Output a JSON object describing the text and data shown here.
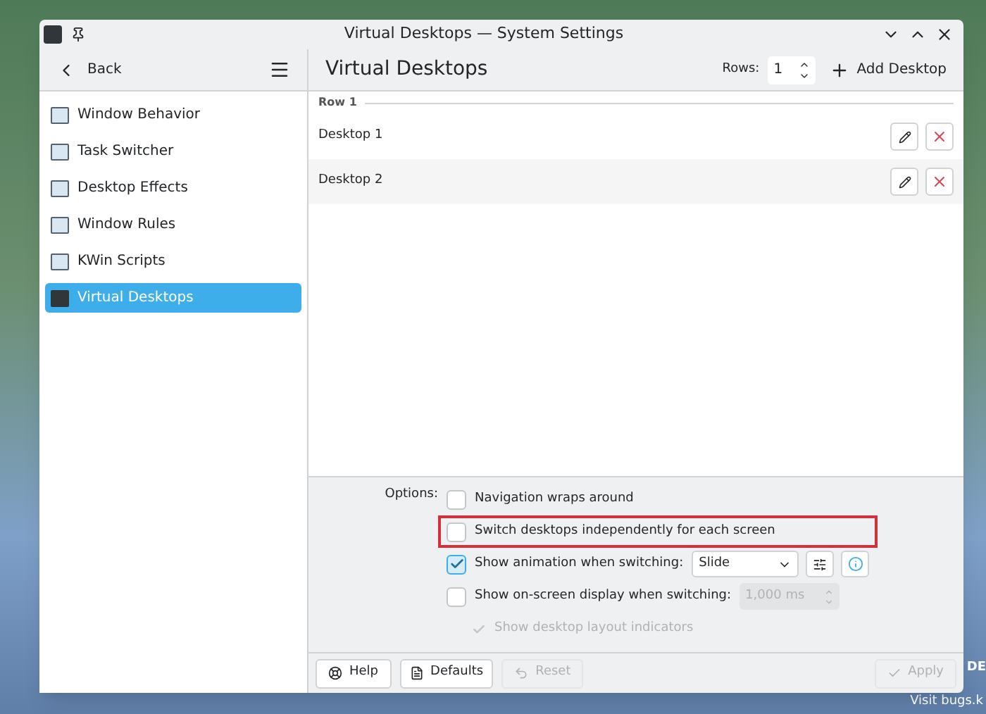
{
  "window": {
    "title": "Virtual Desktops — System Settings"
  },
  "sidebar": {
    "back": "Back",
    "items": [
      {
        "label": "Window Behavior",
        "selected": false
      },
      {
        "label": "Task Switcher",
        "selected": false
      },
      {
        "label": "Desktop Effects",
        "selected": false
      },
      {
        "label": "Window Rules",
        "selected": false
      },
      {
        "label": "KWin Scripts",
        "selected": false
      },
      {
        "label": "Virtual Desktops",
        "selected": true
      }
    ]
  },
  "header": {
    "title": "Virtual Desktops",
    "rows_label": "Rows:",
    "rows_value": "1",
    "add_button": "Add Desktop"
  },
  "desktops": {
    "row_label": "Row 1",
    "items": [
      {
        "name": "Desktop 1"
      },
      {
        "name": "Desktop 2"
      }
    ]
  },
  "options": {
    "label": "Options:",
    "items": [
      {
        "kind": "checkbox",
        "label": "Navigation wraps around",
        "checked": false,
        "disabled": false,
        "highlighted": false
      },
      {
        "kind": "checkbox",
        "label": "Switch desktops independently for each screen",
        "checked": false,
        "disabled": false,
        "highlighted": true
      },
      {
        "kind": "select",
        "label": "Show animation when switching:",
        "checked": true,
        "disabled": false,
        "highlighted": false,
        "value": "Slide"
      },
      {
        "kind": "spin",
        "label": "Show on-screen display when switching:",
        "checked": false,
        "disabled": false,
        "highlighted": false,
        "value": "1,000 ms"
      },
      {
        "kind": "tick",
        "label": "Show desktop layout indicators",
        "checked": true,
        "disabled": true,
        "highlighted": false
      }
    ]
  },
  "footer": {
    "help": "Help",
    "defaults": "Defaults",
    "reset": "Reset",
    "apply": "Apply"
  },
  "wallpaper_text": [
    "DE",
    "Visit bugs.k"
  ]
}
